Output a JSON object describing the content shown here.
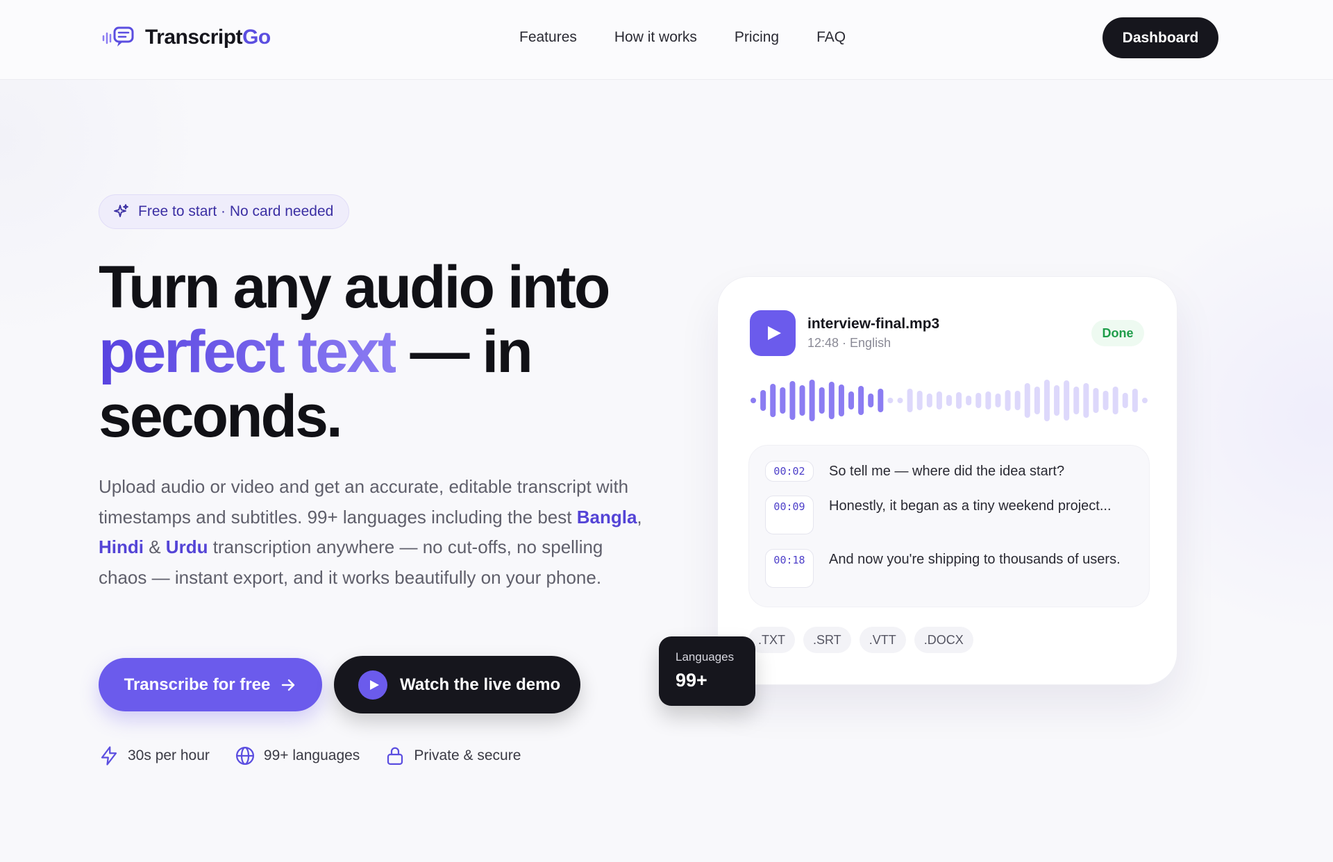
{
  "brand": {
    "name_main": "Transcript",
    "name_accent": "Go",
    "accent_color": "#5b4ee0"
  },
  "nav": {
    "items": [
      "Features",
      "How it works",
      "Pricing",
      "FAQ"
    ],
    "dashboard_label": "Dashboard"
  },
  "hero": {
    "pill_label": "Free to start · No card needed",
    "headline_line1": "Turn any audio into",
    "headline_accent": "perfect text",
    "headline_rest": " — in",
    "headline_line3": "seconds.",
    "lead_part1": "Upload audio or video and get an accurate, editable transcript with timestamps and subtitles. 99+ languages including the best ",
    "lead_lang1": "Bangla",
    "lead_sep1": ", ",
    "lead_lang2": "Hindi",
    "lead_sep2": " & ",
    "lead_lang3": "Urdu",
    "lead_part2": " transcription anywhere — no cut-offs, no spelling chaos — instant export, and it works beautifully on your phone.",
    "cta_primary": "Transcribe for free",
    "cta_secondary": "Watch the live demo",
    "features": [
      {
        "icon": "lightning-icon",
        "label": "30s per hour"
      },
      {
        "icon": "globe-icon",
        "label": "99+ languages"
      },
      {
        "icon": "lock-icon",
        "label": "Private & secure"
      }
    ]
  },
  "card": {
    "file_name": "interview-final.mp3",
    "file_meta": "12:48 · English",
    "status": "Done",
    "status_color": "#1f9d4a",
    "transcript": [
      {
        "time": "00:02",
        "text": "So tell me — where did the idea start?"
      },
      {
        "time": "00:09",
        "text": "Honestly, it began as a tiny weekend project..."
      },
      {
        "time": "00:18",
        "text": "And now you're shipping to thousands of users."
      }
    ],
    "formats": [
      ".TXT",
      ".SRT",
      ".VTT",
      ".DOCX"
    ]
  },
  "languages_badge": {
    "label": "Languages",
    "value": "99+"
  }
}
